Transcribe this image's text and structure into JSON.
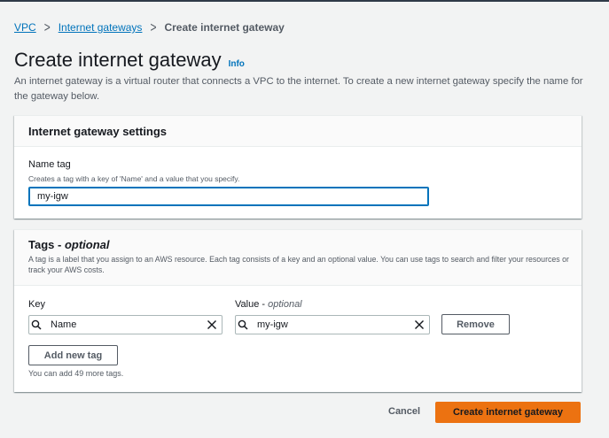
{
  "breadcrumb": {
    "items": [
      "VPC",
      "Internet gateways"
    ],
    "current": "Create internet gateway"
  },
  "page": {
    "title": "Create internet gateway",
    "info_link": "Info",
    "description": "An internet gateway is a virtual router that connects a VPC to the internet. To create a new internet gateway specify the name for the gateway below."
  },
  "settings": {
    "header": "Internet gateway settings",
    "name_tag_label": "Name tag",
    "name_tag_hint": "Creates a tag with a key of 'Name' and a value that you specify.",
    "name_tag_value": "my-igw"
  },
  "tags": {
    "header_prefix": "Tags - ",
    "header_optional": "optional",
    "description": "A tag is a label that you assign to an AWS resource. Each tag consists of a key and an optional value. You can use tags to search and filter your resources or track your AWS costs.",
    "key_label": "Key",
    "value_label_prefix": "Value - ",
    "value_label_optional": "optional",
    "rows": [
      {
        "key": "Name",
        "value": "my-igw",
        "remove_label": "Remove"
      }
    ],
    "add_button": "Add new tag",
    "remaining_note": "You can add 49 more tags."
  },
  "footer": {
    "cancel": "Cancel",
    "submit": "Create internet gateway"
  },
  "colors": {
    "link": "#0073bb",
    "primary": "#ec7211",
    "background": "#f2f3f3"
  }
}
